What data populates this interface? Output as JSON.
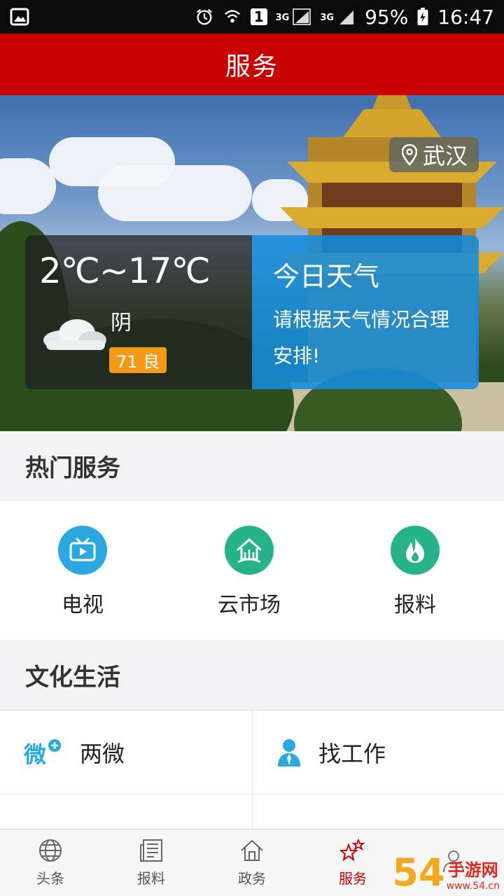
{
  "status_bar": {
    "battery": "95%",
    "time": "16:47",
    "network_1": "3G",
    "network_2": "3G",
    "sim": "1"
  },
  "header": {
    "title": "服务"
  },
  "weather": {
    "city": "武汉",
    "temperature": "2℃~17℃",
    "condition": "阴",
    "aqi": "71 良",
    "today_title": "今日天气",
    "today_text": "请根据天气情况合理安排!"
  },
  "hot_services": {
    "title": "热门服务",
    "items": [
      {
        "label": "电视",
        "icon": "tv-icon",
        "color": "#2aa9e0"
      },
      {
        "label": "云市场",
        "icon": "market-icon",
        "color": "#27b38a"
      },
      {
        "label": "报料",
        "icon": "flame-icon",
        "color": "#27b38a"
      }
    ]
  },
  "culture": {
    "title": "文化生活",
    "items": [
      {
        "label": "两微",
        "icon": "weibo-plus-icon"
      },
      {
        "label": "找工作",
        "icon": "person-icon"
      }
    ]
  },
  "bottom_nav": {
    "items": [
      {
        "label": "头条",
        "icon": "globe-icon"
      },
      {
        "label": "报料",
        "icon": "newspaper-icon"
      },
      {
        "label": "政务",
        "icon": "home-icon"
      },
      {
        "label": "服务",
        "icon": "stars-icon",
        "active": true
      },
      {
        "label": "",
        "icon": "user-icon"
      }
    ]
  },
  "watermark": {
    "logo": "54",
    "text": "手游网",
    "url": "www.54.cn"
  },
  "colors": {
    "brand_red": "#c90000",
    "weather_blue": "#1e8fd8",
    "aqi_orange": "#f39a1a"
  }
}
